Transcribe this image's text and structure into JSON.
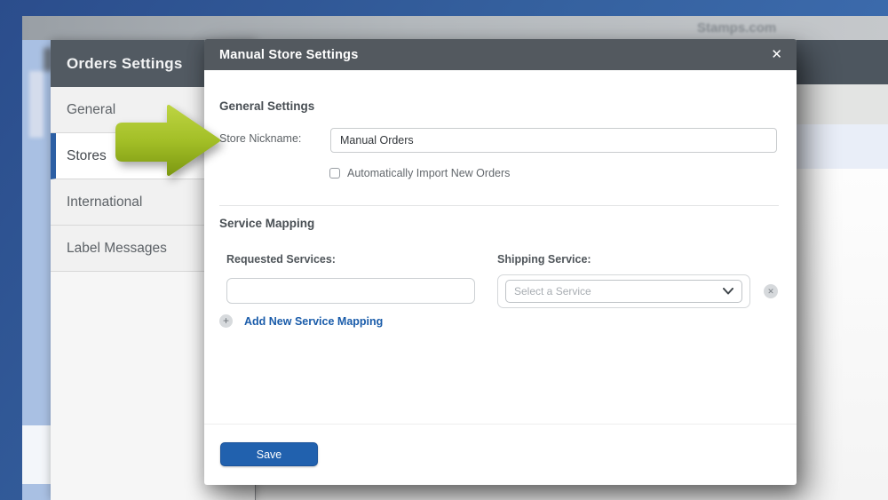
{
  "page": {
    "watermark": "Stamps.com"
  },
  "settings_panel": {
    "title": "Orders Settings",
    "items": [
      {
        "label": "General",
        "active": false
      },
      {
        "label": "Stores",
        "active": true
      },
      {
        "label": "International",
        "active": false
      },
      {
        "label": "Label Messages",
        "active": false
      }
    ]
  },
  "modal": {
    "title": "Manual Store Settings",
    "close_icon": "✕",
    "general_section": {
      "heading": "General Settings",
      "store_nickname_label": "Store Nickname:",
      "store_nickname_value": "Manual Orders",
      "auto_import_label": "Automatically Import New Orders",
      "auto_import_checked": false
    },
    "service_mapping_section": {
      "heading": "Service Mapping",
      "requested_services_label": "Requested Services:",
      "requested_services_value": "",
      "shipping_service_label": "Shipping Service:",
      "shipping_service_placeholder": "Select a Service",
      "remove_icon": "✕",
      "add_icon": "+",
      "add_link_label": "Add New Service Mapping"
    },
    "footer": {
      "save_label": "Save"
    }
  },
  "colors": {
    "accent_blue": "#2161ae",
    "active_tab_bar": "#2c5fa4",
    "panel_header": "#525a62",
    "modal_header": "#53595f",
    "arrow_green": "#a3bf27",
    "link_blue": "#1a5caa"
  }
}
